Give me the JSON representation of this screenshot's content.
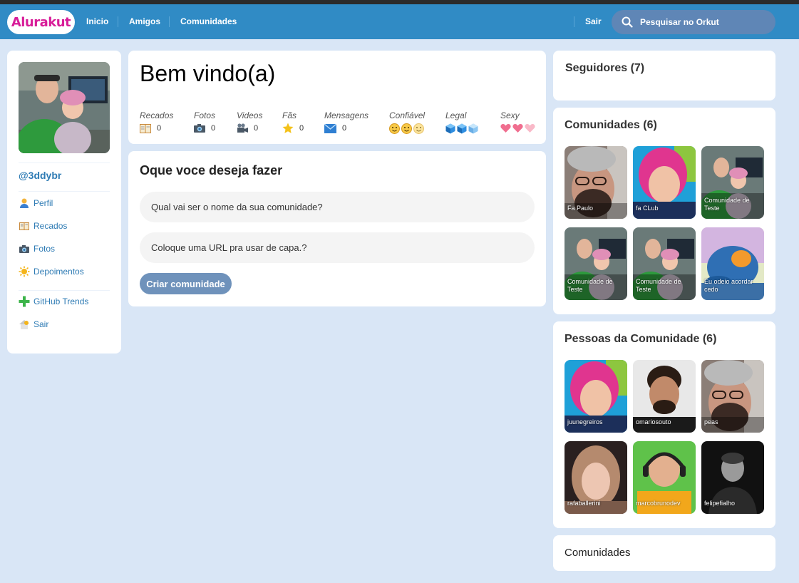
{
  "header": {
    "logo": "Alurakut",
    "nav": [
      "Inicio",
      "Amigos",
      "Comunidades"
    ],
    "logout": "Sair",
    "search_placeholder": "Pesquisar no Orkut"
  },
  "sidebar": {
    "username": "@3ddybr",
    "items": [
      {
        "label": "Perfil",
        "icon": "user-icon"
      },
      {
        "label": "Recados",
        "icon": "book-icon"
      },
      {
        "label": "Fotos",
        "icon": "camera-icon"
      },
      {
        "label": "Depoimentos",
        "icon": "sun-icon"
      }
    ],
    "items2": [
      {
        "label": "GitHub Trends",
        "icon": "plus-icon"
      },
      {
        "label": "Sair",
        "icon": "house-icon"
      }
    ]
  },
  "welcome": {
    "title": "Bem vindo(a)",
    "stats": [
      {
        "label": "Recados",
        "value": "0",
        "icon": "book-icon"
      },
      {
        "label": "Fotos",
        "value": "0",
        "icon": "camera-icon"
      },
      {
        "label": "Videos",
        "value": "0",
        "icon": "video-camera-icon"
      },
      {
        "label": "Fãs",
        "value": "0",
        "icon": "star-icon"
      },
      {
        "label": "Mensagens",
        "value": "0",
        "icon": "envelope-icon"
      },
      {
        "label": "Confiável",
        "rating": 3,
        "icon": "smiley-icon"
      },
      {
        "label": "Legal",
        "rating": 3,
        "icon": "ice-cube-icon"
      },
      {
        "label": "Sexy",
        "rating": 3,
        "icon": "heart-icon"
      }
    ]
  },
  "form": {
    "title": "Oque voce deseja fazer",
    "name_placeholder": "Qual vai ser o nome da sua comunidade?",
    "url_placeholder": "Coloque uma URL pra usar de capa.?",
    "submit": "Criar comunidade"
  },
  "followers": {
    "title": "Seguidores (7)"
  },
  "communities": {
    "title": "Comunidades (6)",
    "items": [
      "Fa Paulo",
      "fa CLub",
      "Comunidade de Teste",
      "Comunidade de Teste",
      "Comunidade de Teste",
      "Eu odeio acordar cedo"
    ]
  },
  "people": {
    "title": "Pessoas da Comunidade (6)",
    "items": [
      "juunegreiros",
      "omariosouto",
      "peas",
      "rafaballerini",
      "marcobrunodev",
      "felipefialho"
    ]
  },
  "footer_box": {
    "title": "Comunidades"
  },
  "colors": {
    "topbar": "#308bc5",
    "background": "#d9e6f6",
    "logo_pink": "#d81d99",
    "link_blue": "#2e7bb4",
    "button": "#6f92bb"
  }
}
